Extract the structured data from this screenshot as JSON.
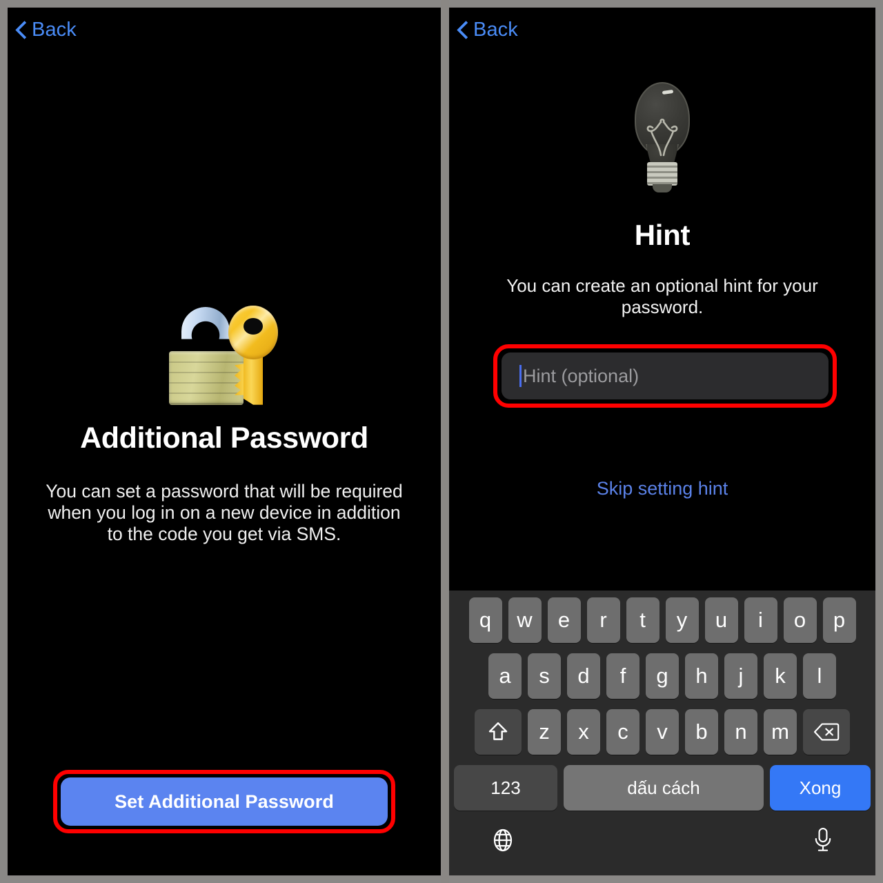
{
  "colors": {
    "frame": "#8a8886",
    "panel_bg": "#000000",
    "accent_blue": "#4a8cf7",
    "highlight_red": "#ff0000",
    "primary_button": "#5b84f0",
    "key_letter": "#6e6e6e",
    "key_modifier": "#474747",
    "key_done": "#3478f6",
    "keyboard_bg": "#2b2b2b",
    "field_bg": "#2c2c2e"
  },
  "left_panel": {
    "nav": {
      "back_label": "Back",
      "back_icon": "chevron-left-icon"
    },
    "illustration_icon": "locked-with-key-icon",
    "title": "Additional Password",
    "description": "You can set a password that will be required when you log in on a new device in addition to the code you get via SMS.",
    "primary_button_label": "Set Additional Password",
    "primary_button_highlighted": "true"
  },
  "right_panel": {
    "nav": {
      "back_label": "Back",
      "back_icon": "chevron-left-icon"
    },
    "illustration_icon": "light-bulb-icon",
    "title": "Hint",
    "description": "You can create an optional hint for your password.",
    "hint_input": {
      "value": "",
      "placeholder": "Hint (optional)",
      "focused": "true",
      "highlighted": "true"
    },
    "skip_link_label": "Skip setting hint"
  },
  "keyboard": {
    "language": "Vietnamese",
    "rows": [
      [
        "q",
        "w",
        "e",
        "r",
        "t",
        "y",
        "u",
        "i",
        "o",
        "p"
      ],
      [
        "a",
        "s",
        "d",
        "f",
        "g",
        "h",
        "j",
        "k",
        "l"
      ],
      [
        "z",
        "x",
        "c",
        "v",
        "b",
        "n",
        "m"
      ]
    ],
    "shift_icon": "shift-arrow-icon",
    "backspace_icon": "backspace-icon",
    "numbers_key_label": "123",
    "space_key_label": "dấu cách",
    "done_key_label": "Xong",
    "globe_icon": "globe-icon",
    "mic_icon": "microphone-icon"
  }
}
